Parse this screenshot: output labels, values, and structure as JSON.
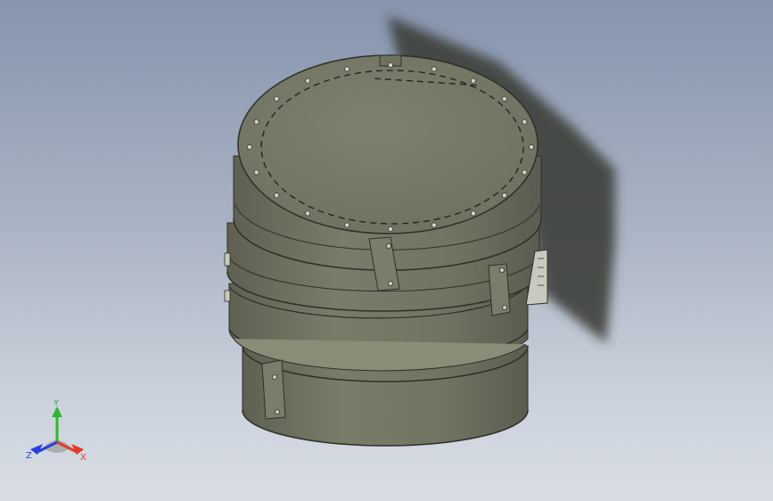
{
  "viewport": {
    "background_top": "#8694ad",
    "background_bottom": "#d8dde5"
  },
  "model": {
    "shape": "cylindrical drum with stacked rings, clamp plates and bolted lid",
    "body_color": "#6f7160",
    "shadow_color": "#3c3f3a"
  },
  "triad": {
    "x_label": "X",
    "y_label": "Y",
    "z_label": "Z",
    "x_color": "#e03a2a",
    "y_color": "#2fb52f",
    "z_color": "#2a3ee0"
  }
}
